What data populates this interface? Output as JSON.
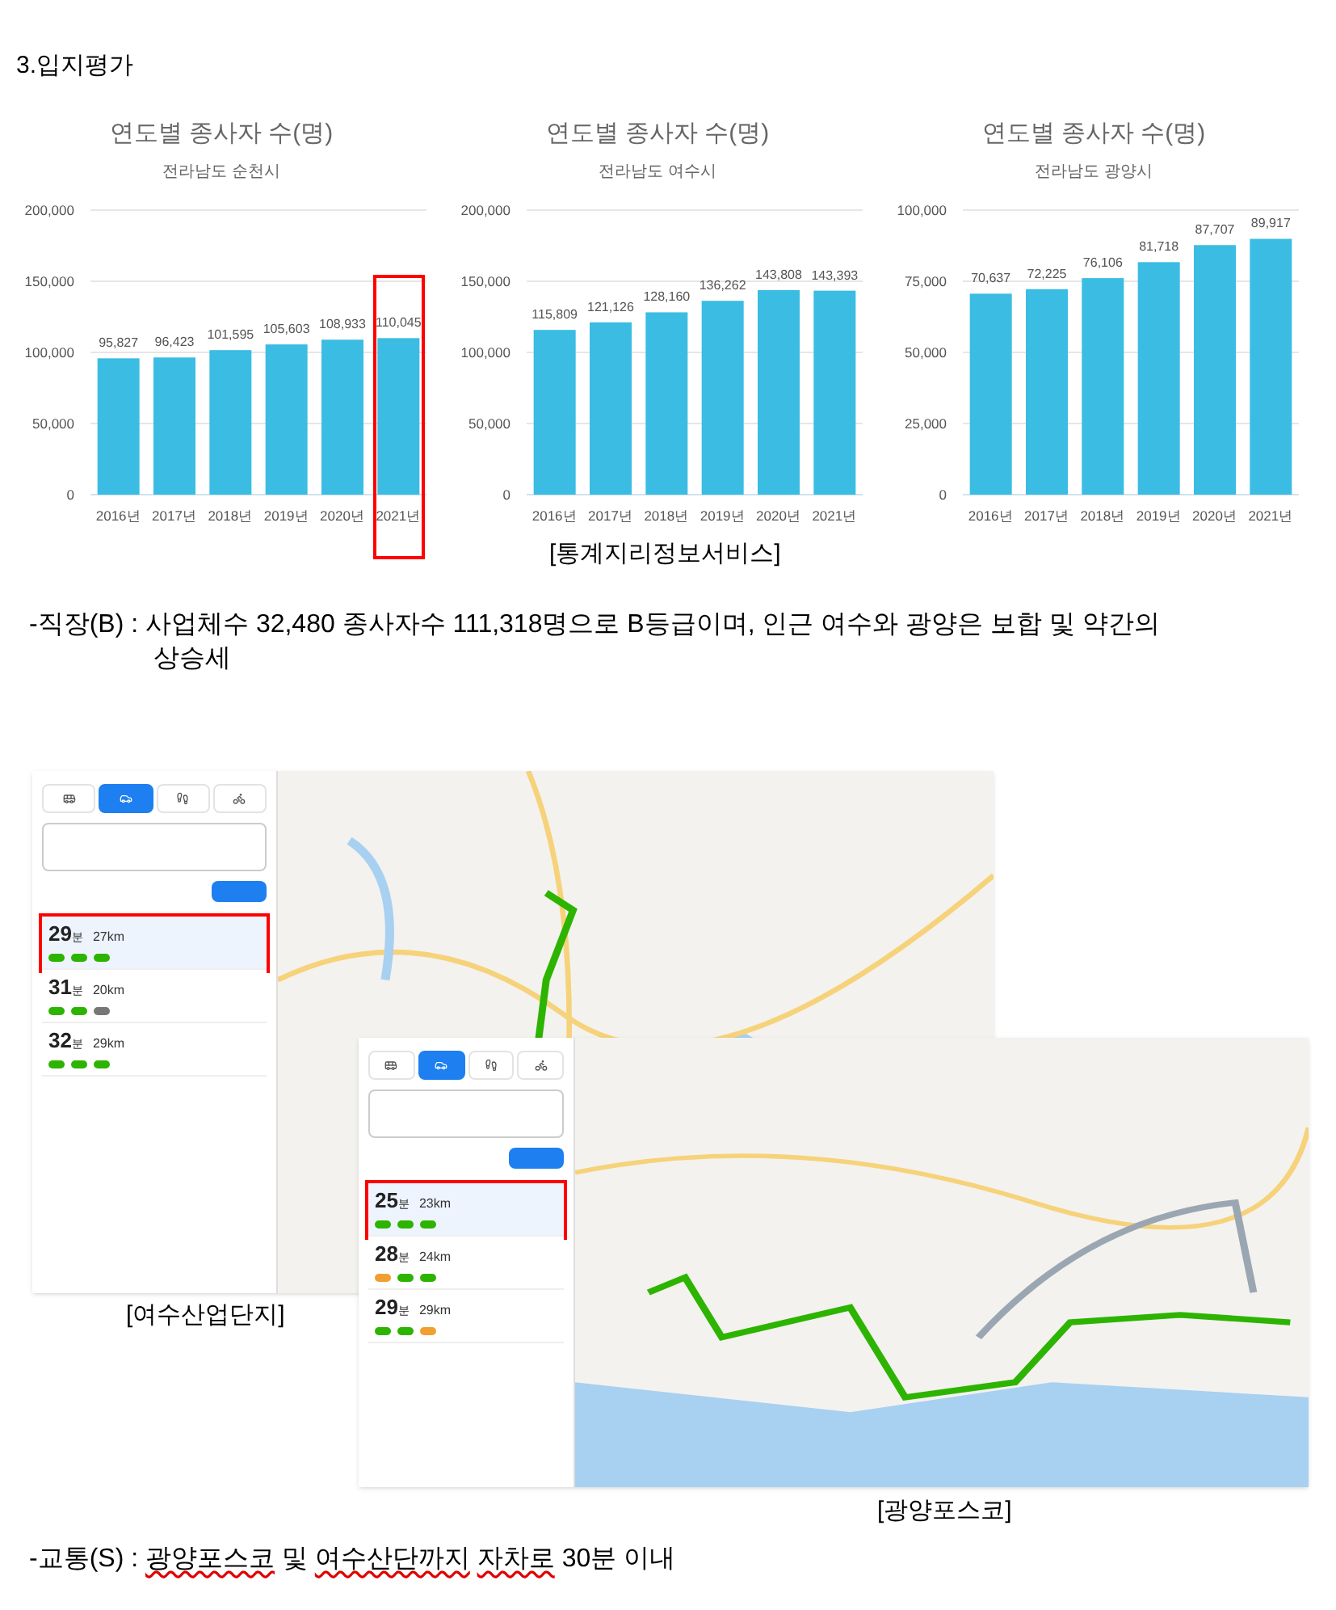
{
  "heading": "3.입지평가",
  "charts": [
    {
      "subtitle": "전라남도 순천시",
      "highlight_last_bar": true,
      "chart_data": {
        "type": "bar",
        "title": "연도별 종사자 수(명)",
        "categories": [
          "2016년",
          "2017년",
          "2018년",
          "2019년",
          "2020년",
          "2021년"
        ],
        "series": [
          {
            "color": "#3bbce3",
            "values": [
              95827,
              96423,
              101595,
              105603,
              108933,
              110045
            ]
          }
        ],
        "ylim": [
          0,
          200000
        ],
        "yticks": [
          {
            "value": 0,
            "label": "0"
          },
          {
            "value": 50000,
            "label": "50,000"
          },
          {
            "value": 100000,
            "label": "100,000"
          },
          {
            "value": 150000,
            "label": "150,000"
          },
          {
            "value": 200000,
            "label": "200,000"
          }
        ],
        "grid": true,
        "value_labels": [
          "95,827",
          "96,423",
          "101,595",
          "105,603",
          "108,933",
          "110,045"
        ]
      }
    },
    {
      "subtitle": "전라남도 여수시",
      "highlight_last_bar": false,
      "chart_data": {
        "type": "bar",
        "title": "연도별 종사자 수(명)",
        "categories": [
          "2016년",
          "2017년",
          "2018년",
          "2019년",
          "2020년",
          "2021년"
        ],
        "series": [
          {
            "color": "#3bbce3",
            "values": [
              115809,
              121126,
              128160,
              136262,
              143808,
              143393
            ]
          }
        ],
        "ylim": [
          0,
          200000
        ],
        "yticks": [
          {
            "value": 0,
            "label": "0"
          },
          {
            "value": 50000,
            "label": "50,000"
          },
          {
            "value": 100000,
            "label": "100,000"
          },
          {
            "value": 150000,
            "label": "150,000"
          },
          {
            "value": 200000,
            "label": "200,000"
          }
        ],
        "grid": true,
        "value_labels": [
          "115,809",
          "121,126",
          "128,160",
          "136,262",
          "143,808",
          "143,393"
        ]
      }
    },
    {
      "subtitle": "전라남도 광양시",
      "highlight_last_bar": false,
      "chart_data": {
        "type": "bar",
        "title": "연도별 종사자 수(명)",
        "categories": [
          "2016년",
          "2017년",
          "2018년",
          "2019년",
          "2020년",
          "2021년"
        ],
        "series": [
          {
            "color": "#3bbce3",
            "values": [
              70637,
              72225,
              76106,
              81718,
              87707,
              89917
            ]
          }
        ],
        "ylim": [
          0,
          100000
        ],
        "yticks": [
          {
            "value": 0,
            "label": "0"
          },
          {
            "value": 25000,
            "label": "25,000"
          },
          {
            "value": 50000,
            "label": "50,000"
          },
          {
            "value": 75000,
            "label": "75,000"
          },
          {
            "value": 100000,
            "label": "100,000"
          }
        ],
        "grid": true,
        "value_labels": [
          "70,637",
          "72,225",
          "76,106",
          "81,718",
          "87,707",
          "89,917"
        ]
      }
    }
  ],
  "chart_caption": "[통계지리정보서비스]",
  "workplace_text": "-직장(B) : 사업체수 32,480 종사자수 111,318명으로 B등급이며, 인근 여수와 광양은 보합 및 약간의 상승세",
  "map_screens": [
    {
      "caption": "[여수산업단지]",
      "tabs": [
        {
          "kind": "bus",
          "selected": false
        },
        {
          "kind": "car",
          "selected": true
        },
        {
          "kind": "walk",
          "selected": false
        },
        {
          "kind": "bike",
          "selected": false
        }
      ],
      "routes": [
        {
          "minutes": "29",
          "unit": "분",
          "distance": "27km",
          "selected": true,
          "highlighted": true,
          "badges": [
            {
              "color": "#2db400"
            },
            {
              "color": "#2db400"
            },
            {
              "color": "#2db400"
            }
          ]
        },
        {
          "minutes": "31",
          "unit": "분",
          "distance": "20km",
          "selected": false,
          "highlighted": false,
          "badges": [
            {
              "color": "#2db400"
            },
            {
              "color": "#2db400"
            },
            {
              "color": "#777777"
            }
          ]
        },
        {
          "minutes": "32",
          "unit": "분",
          "distance": "29km",
          "selected": false,
          "highlighted": false,
          "badges": [
            {
              "color": "#2db400"
            },
            {
              "color": "#2db400"
            },
            {
              "color": "#2db400"
            }
          ]
        }
      ]
    },
    {
      "caption": "[광양포스코]",
      "tabs": [
        {
          "kind": "bus",
          "selected": false
        },
        {
          "kind": "car",
          "selected": true
        },
        {
          "kind": "walk",
          "selected": false
        },
        {
          "kind": "bike",
          "selected": false
        }
      ],
      "routes": [
        {
          "minutes": "25",
          "unit": "분",
          "distance": "23km",
          "selected": true,
          "highlighted": true,
          "badges": [
            {
              "color": "#2db400"
            },
            {
              "color": "#2db400"
            },
            {
              "color": "#2db400"
            }
          ]
        },
        {
          "minutes": "28",
          "unit": "분",
          "distance": "24km",
          "selected": false,
          "highlighted": false,
          "badges": [
            {
              "color": "#f0a030"
            },
            {
              "color": "#2db400"
            },
            {
              "color": "#2db400"
            }
          ]
        },
        {
          "minutes": "29",
          "unit": "분",
          "distance": "29km",
          "selected": false,
          "highlighted": false,
          "badges": [
            {
              "color": "#2db400"
            },
            {
              "color": "#2db400"
            },
            {
              "color": "#f0a030"
            }
          ]
        }
      ]
    }
  ],
  "traffic_text": [
    {
      "text": "-교통(S) :",
      "misspelled": false
    },
    {
      "text": "광양포스코",
      "misspelled": true
    },
    {
      "text": "및",
      "misspelled": false
    },
    {
      "text": "여수산단까지",
      "misspelled": true
    },
    {
      "text": "자차로",
      "misspelled": true
    },
    {
      "text": "30분 이내",
      "misspelled": false
    }
  ]
}
